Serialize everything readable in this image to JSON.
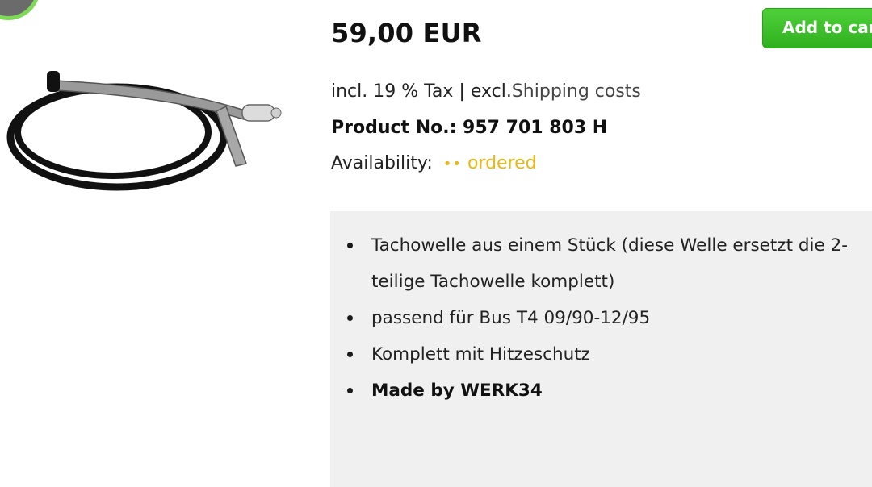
{
  "product": {
    "price": "59,00 EUR",
    "add_to_cart_label": "Add to cart",
    "tax_prefix": "incl. 19 % Tax | excl.",
    "shipping_link": "Shipping costs",
    "product_no": "Product No.: 957 701 803 H",
    "availability_label": "Availability:",
    "availability_dots": "••",
    "availability_status": "ordered",
    "image_icon": "speedometer-cable-image"
  },
  "description": {
    "items": [
      {
        "text": "Tachowelle aus einem Stück (diese Welle ersetzt die 2-teilige Tachowelle komplett)",
        "bold": false
      },
      {
        "text": "passend für Bus T4 09/90-12/95",
        "bold": false
      },
      {
        "text": "Komplett mit Hitzeschutz",
        "bold": false
      },
      {
        "text": "Made by WERK34",
        "bold": true
      }
    ]
  },
  "colors": {
    "accent_green": "#3cc12b",
    "availability_yellow": "#e9b817",
    "description_bg": "#f0f0f0"
  }
}
